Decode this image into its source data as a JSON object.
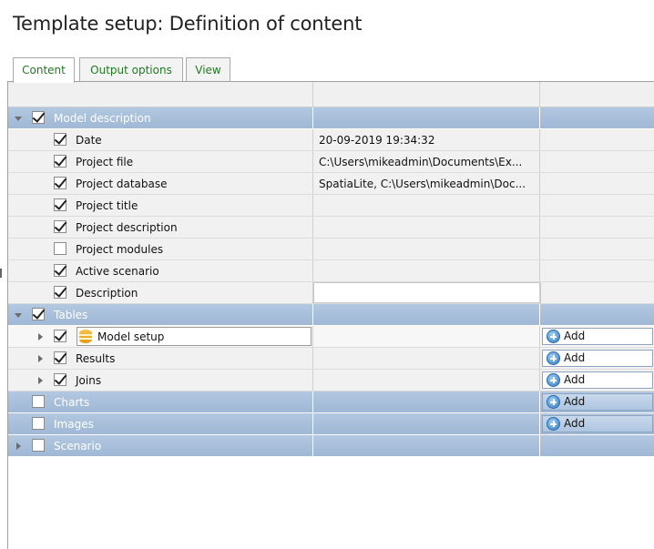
{
  "title": "Template setup: Definition of content",
  "tabs": [
    {
      "label": "Content",
      "active": true
    },
    {
      "label": "Output options",
      "active": false
    },
    {
      "label": "View",
      "active": false
    }
  ],
  "add_label": "Add",
  "colors": {
    "group_band": "#a8bfd9",
    "tab_text": "#1e7a1e",
    "item_bg": "#f1f1f1"
  },
  "groups": {
    "model_description": {
      "label": "Model description",
      "checked": true,
      "expanded": true,
      "items": [
        {
          "label": "Date",
          "checked": true,
          "value": "20-09-2019 19:34:32"
        },
        {
          "label": "Project file",
          "checked": true,
          "value": "C:\\Users\\mikeadmin\\Documents\\Ex..."
        },
        {
          "label": "Project database",
          "checked": true,
          "value": "SpatiaLite, C:\\Users\\mikeadmin\\Doc..."
        },
        {
          "label": "Project title",
          "checked": true,
          "value": ""
        },
        {
          "label": "Project description",
          "checked": true,
          "value": ""
        },
        {
          "label": "Project modules",
          "checked": false,
          "value": ""
        },
        {
          "label": "Active scenario",
          "checked": true,
          "value": ""
        },
        {
          "label": "Description",
          "checked": true,
          "value": ""
        }
      ]
    },
    "tables": {
      "label": "Tables",
      "checked": true,
      "expanded": true,
      "items": [
        {
          "label": "Model setup",
          "checked": true,
          "icon": "database-icon"
        },
        {
          "label": "Results",
          "checked": true
        },
        {
          "label": "Joins",
          "checked": true
        }
      ]
    },
    "charts": {
      "label": "Charts",
      "checked": false
    },
    "images": {
      "label": "Images",
      "checked": false
    },
    "scenario": {
      "label": "Scenario",
      "checked": false,
      "expanded": false
    }
  }
}
